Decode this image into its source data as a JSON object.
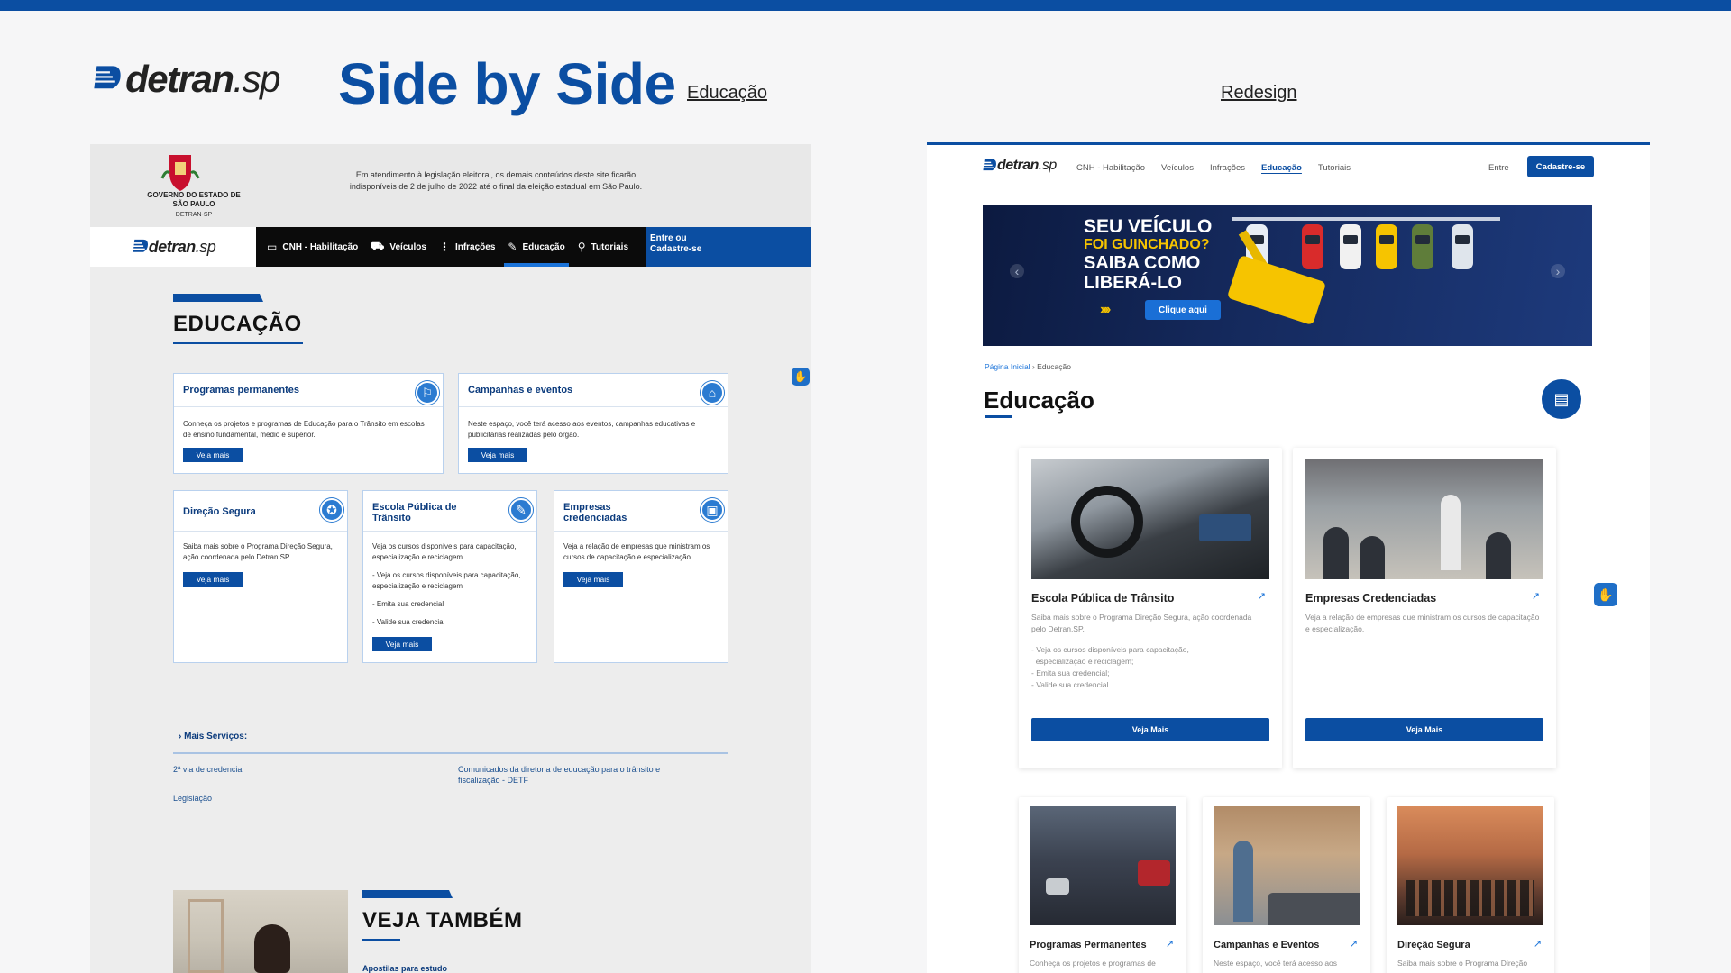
{
  "header": {
    "logo_word": "detran",
    "logo_suffix": ".sp",
    "title": "Side by Side",
    "link_left": "Educação",
    "link_right": "Redesign"
  },
  "old_site": {
    "gov": {
      "name": "GOVERNO DO ESTADO DE SÃO PAULO",
      "sub": "DETRAN-SP",
      "notice": "Em atendimento à legislação eleitoral, os demais conteúdos deste site ficarão indisponíveis de 2 de julho de 2022 até o final da eleição estadual em São Paulo."
    },
    "nav": {
      "logo_word": "detran",
      "logo_suffix": ".sp",
      "items": [
        {
          "label": "CNH - Habilitação",
          "icon": "id-card-icon",
          "glyph": "▭"
        },
        {
          "label": "Veículos",
          "icon": "car-icon",
          "glyph": "⛟"
        },
        {
          "label": "Infrações",
          "icon": "traffic-light-icon",
          "glyph": "⋮"
        },
        {
          "label": "Educação",
          "icon": "pencil-icon",
          "glyph": "✎"
        },
        {
          "label": "Tutoriais",
          "icon": "person-icon",
          "glyph": "⚲"
        }
      ],
      "cta_line1": "Entre ou",
      "cta_line2": "Cadastre-se"
    },
    "page_title": "EDUCAÇÃO",
    "cards": [
      {
        "title": "Programas permanentes",
        "text": "Conheça os projetos e programas de Educação para o Trânsito em escolas de ensino fundamental, médio e superior.",
        "button": "Veja mais"
      },
      {
        "title": "Campanhas e eventos",
        "text": "Neste espaço, você terá acesso aos eventos, campanhas educativas e publicitárias realizadas pelo órgão.",
        "button": "Veja mais"
      },
      {
        "title": "Direção Segura",
        "text": "Saiba mais sobre o Programa Direção Segura, ação coordenada pelo Detran.SP.",
        "button": "Veja mais"
      },
      {
        "title": "Escola Pública de Trânsito",
        "text": "Veja os cursos disponíveis para capacitação, especialização e reciclagem.",
        "bullets": [
          "- Veja os cursos disponíveis para capacitação, especialização e reciclagem",
          "- Emita sua credencial",
          "- Valide sua credencial"
        ],
        "button": "Veja mais"
      },
      {
        "title": "Empresas credenciadas",
        "text": "Veja a relação de empresas que ministram os cursos de capacitação e especialização.",
        "button": "Veja mais"
      }
    ],
    "mais_servicos": {
      "title": "› Mais Serviços:",
      "links": [
        "2ª via de credencial",
        "Comunicados da diretoria de educação para o trânsito e fiscalização - DETF",
        "Legislação"
      ]
    },
    "veja_tambem": {
      "title": "VEJA TAMBÉM",
      "sub": "Apostilas para estudo"
    }
  },
  "redesign": {
    "nav": {
      "logo_word": "detran",
      "logo_suffix": ".sp",
      "items": [
        "CNH - Habilitação",
        "Veículos",
        "Infrações",
        "Educação",
        "Tutoriais"
      ],
      "active": "Educação",
      "login": "Entre",
      "signup": "Cadastre-se"
    },
    "banner": {
      "line1": "SEU VEÍCULO",
      "line2": "FOI GUINCHADO?",
      "line3": "SAIBA COMO LIBERÁ-LO",
      "cta": "Clique aqui",
      "prev": "‹",
      "next": "›",
      "car_colors": [
        "#e8eef5",
        "#d92b2b",
        "#f1f1f1",
        "#f6c400",
        "#5f7d3a",
        "#dfe5ec"
      ]
    },
    "breadcrumb": {
      "home": "Página Inicial",
      "sep": "›",
      "current": "Educação"
    },
    "page_title": "Educação",
    "cards_top": [
      {
        "title": "Escola Pública de Trânsito",
        "text": "Saiba mais sobre o Programa Direção Segura, ação coordenada pelo Detran.SP.",
        "bullets": [
          "- Veja os cursos disponíveis para capacitação,",
          "  especialização e reciclagem;",
          "- Emita sua credencial;",
          "- Valide sua credencial."
        ],
        "button": "Veja Mais"
      },
      {
        "title": "Empresas Credenciadas",
        "text": "Veja a relação de empresas que ministram os cursos de capacitação e especialização.",
        "button": "Veja Mais"
      }
    ],
    "cards_bottom": [
      {
        "title": "Programas Permanentes",
        "text": "Conheça os projetos e programas de"
      },
      {
        "title": "Campanhas e Eventos",
        "text": "Neste espaço, você terá acesso aos"
      },
      {
        "title": "Direção Segura",
        "text": "Saiba mais sobre o Programa Direção"
      }
    ],
    "link_arrow": "↗"
  },
  "colors": {
    "brand_blue": "#0b4ea2",
    "accent_blue": "#1a73d9",
    "yellow": "#f6c400"
  }
}
